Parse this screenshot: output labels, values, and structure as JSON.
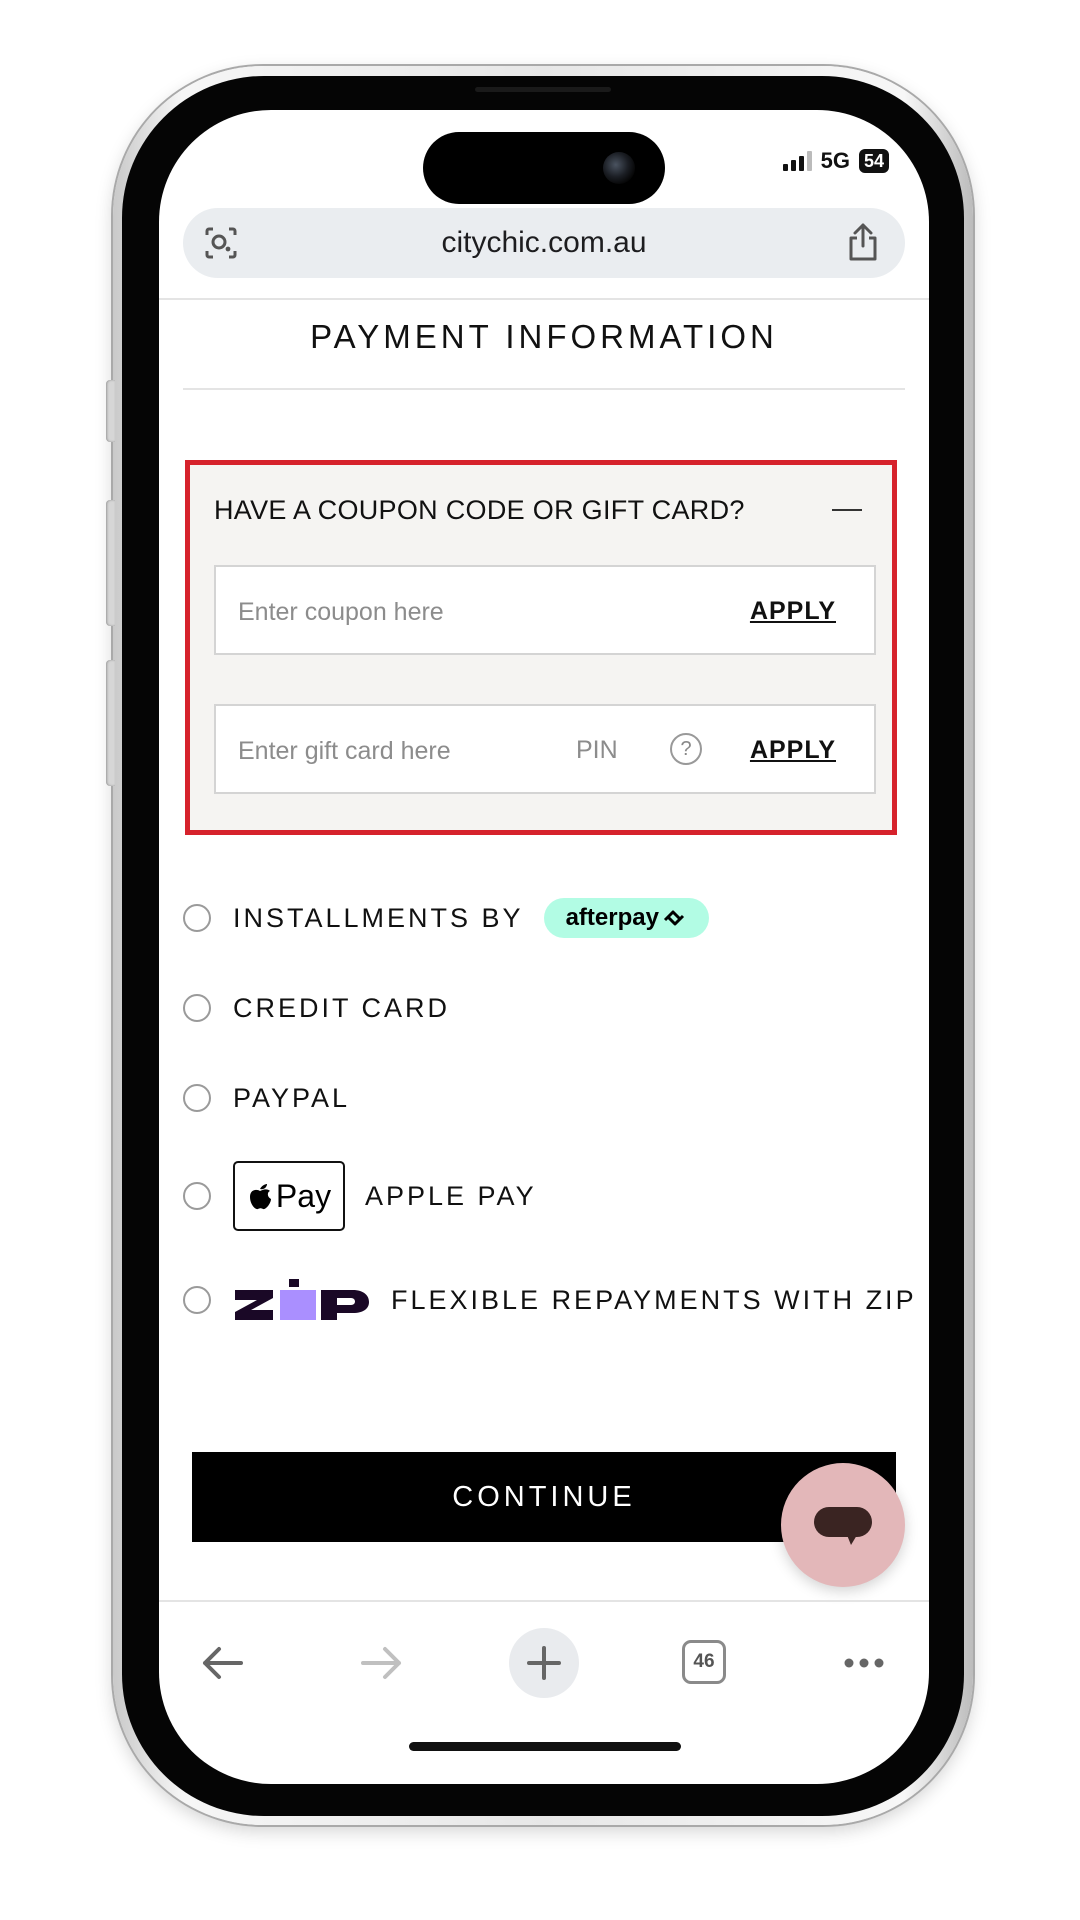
{
  "status_bar": {
    "network": "5G",
    "battery": "54"
  },
  "browser": {
    "url": "citychic.com.au",
    "tab_count": "46"
  },
  "page": {
    "title": "PAYMENT INFORMATION"
  },
  "coupon": {
    "heading": "HAVE A COUPON CODE OR GIFT CARD?",
    "coupon_placeholder": "Enter coupon here",
    "coupon_apply": "APPLY",
    "giftcard_placeholder": "Enter gift card here",
    "pin_label": "PIN",
    "help_glyph": "?",
    "giftcard_apply": "APPLY",
    "highlight_color": "#d6222c"
  },
  "payment_options": [
    {
      "label": "INSTALLMENTS BY",
      "badge": "afterpay",
      "selected": false
    },
    {
      "label": "CREDIT CARD",
      "selected": false
    },
    {
      "label": "PAYPAL",
      "selected": false
    },
    {
      "label": "APPLE PAY",
      "badge": "Pay",
      "selected": false
    },
    {
      "label": "FLEXIBLE REPAYMENTS WITH ZIP",
      "badge": "zip",
      "selected": false
    }
  ],
  "continue_label": "CONTINUE",
  "colors": {
    "afterpay_mint": "#b2fce4",
    "zip_purple": "#aa8fff",
    "chat_pink": "#e3b7b9"
  }
}
